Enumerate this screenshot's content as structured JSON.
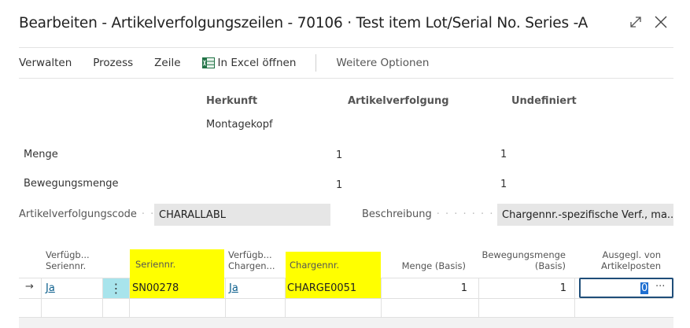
{
  "window": {
    "title": "Bearbeiten - Artikelverfolgungszeilen - 70106 · Test item Lot/Serial No. Series -A"
  },
  "actions": {
    "verwalten": "Verwalten",
    "prozess": "Prozess",
    "zeile": "Zeile",
    "excel": "In Excel öffnen",
    "weitere": "Weitere Optionen"
  },
  "summary": {
    "col_herkunft": "Herkunft",
    "col_artikelverfolgung": "Artikelverfolgung",
    "col_undefiniert": "Undefiniert",
    "source_name": "Montagekopf",
    "menge_label": "Menge",
    "menge_herkunft": "1",
    "menge_undefiniert": "1",
    "bewegung_label": "Bewegungsmenge",
    "bewegung_herkunft": "1",
    "bewegung_undefiniert": "1"
  },
  "fields": {
    "code_label": "Artikelverfolgungscode",
    "code_value": "CHARALLABL",
    "beschreibung_label": "Beschreibung",
    "beschreibung_value": "Chargennr.-spezifische Verf., ma..."
  },
  "grid": {
    "headers": {
      "avail_serial_1": "Verfügb...",
      "avail_serial_2": "Seriennr.",
      "serial": "Seriennr.",
      "avail_lot_1": "Verfügb...",
      "avail_lot_2": "Chargen...",
      "lot": "Chargennr.",
      "qty_base": "Menge (Basis)",
      "move_qty_1": "Bewegungsmenge",
      "move_qty_2": "(Basis)",
      "applied_1": "Ausgegl. von",
      "applied_2": "Artikelposten"
    },
    "row": {
      "avail_serial": "Ja",
      "serial": "SN00278",
      "avail_lot": "Ja",
      "lot": "CHARGE0051",
      "qty_base": "1",
      "move_qty": "1",
      "applied": "0"
    },
    "more_glyph": "···",
    "row_menu_glyph": "⋮",
    "row_arrow_glyph": "→"
  },
  "colors": {
    "highlight": "#ffff00",
    "row_menu_bg": "#a8e4ec",
    "focus_border": "#1f4e79",
    "selected_text_bg": "#1f6fd1"
  },
  "icons": {
    "excel": "excel-icon",
    "expand": "expand-icon",
    "close": "close-icon"
  }
}
